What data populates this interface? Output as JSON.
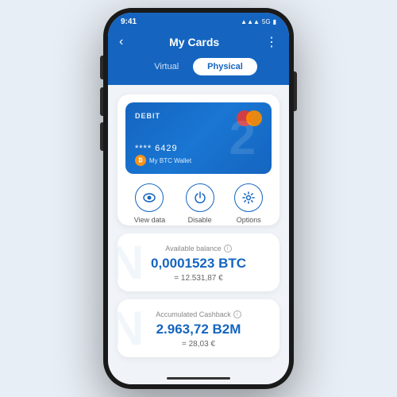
{
  "status_bar": {
    "time": "9:41",
    "signal": "5G"
  },
  "header": {
    "back_icon": "‹",
    "title": "My Cards",
    "more_icon": "⋮"
  },
  "tabs": [
    {
      "label": "Virtual",
      "active": false
    },
    {
      "label": "Physical",
      "active": true
    }
  ],
  "card": {
    "type_label": "DEBIT",
    "watermark": "2",
    "number": "**** 6429",
    "wallet_label": "My BTC Wallet"
  },
  "actions": [
    {
      "label": "View data",
      "icon": "eye"
    },
    {
      "label": "Disable",
      "icon": "power"
    },
    {
      "label": "Options",
      "icon": "gear"
    }
  ],
  "available_balance": {
    "label": "Available balance",
    "amount": "0,0001523 BTC",
    "sub": "= 12.531,87 €",
    "watermark": "N"
  },
  "cashback": {
    "label": "Accumulated Cashback",
    "amount": "2.963,72 B2M",
    "sub": "= 28,03 €",
    "watermark": "N"
  }
}
